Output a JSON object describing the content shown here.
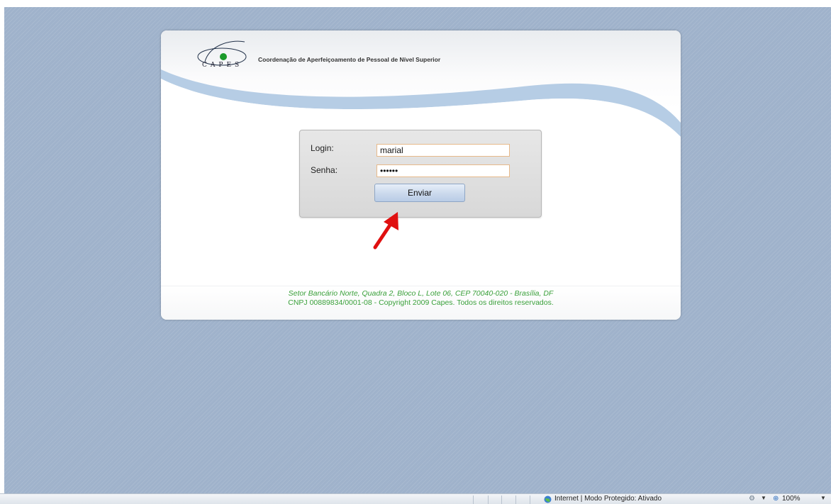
{
  "header": {
    "logo_text": "CAPES",
    "org_name": "Coordenação de Aperfeiçoamento de Pessoal de Nível Superior"
  },
  "login": {
    "login_label": "Login:",
    "login_value": "marial",
    "password_label": "Senha:",
    "password_value": "••••••",
    "submit_label": "Enviar"
  },
  "footer": {
    "address": "Setor Bancário Norte, Quadra 2, Bloco L, Lote 06, CEP 70040-020 - Brasília, DF",
    "copyright": "CNPJ 00889834/0001-08 - Copyright 2009 Capes. Todos os direitos reservados."
  },
  "statusbar": {
    "zone_text": "Internet | Modo Protegido: Ativado",
    "zoom": "100%",
    "icons": [
      "globe-icon",
      "security-icon",
      "zoom-icon"
    ]
  },
  "colors": {
    "background": "#9fb2cb",
    "footer_text": "#3aa03a",
    "swoosh": "#a9c4e0",
    "arrow": "#e01010",
    "logo_dot": "#1a9a2a"
  }
}
